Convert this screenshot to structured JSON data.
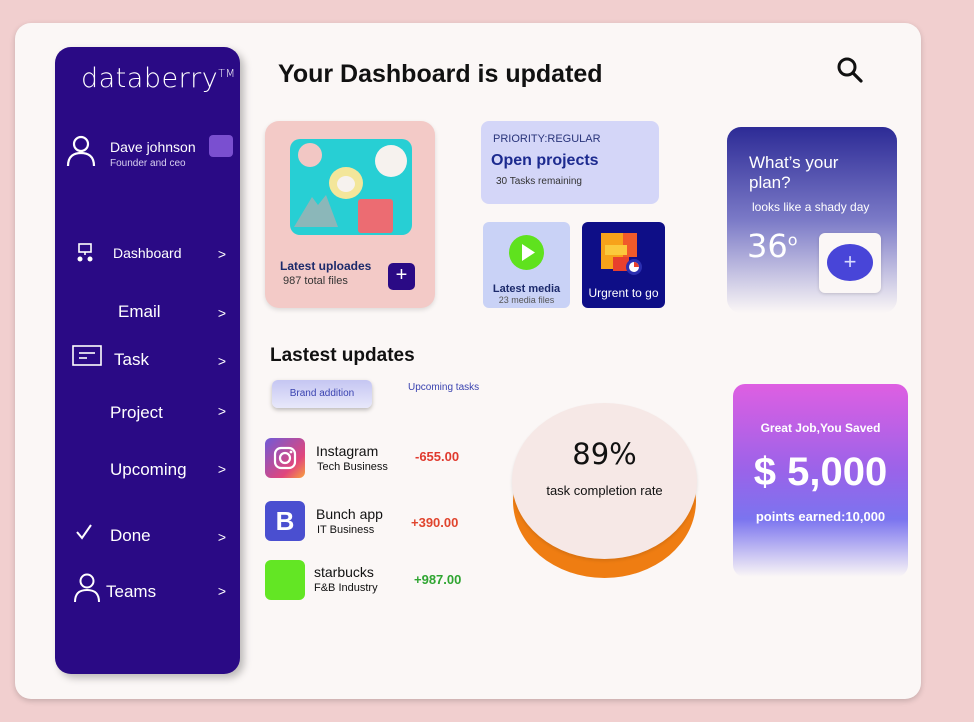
{
  "sidebar": {
    "logo": "databerry",
    "logo_tm": "TM",
    "user": {
      "name": "Dave johnson",
      "role": "Founder and ceo"
    },
    "items": [
      {
        "label": "Dashboard",
        "chevron": ">"
      },
      {
        "label": "Email",
        "chevron": ">"
      },
      {
        "label": "Task",
        "chevron": ">"
      },
      {
        "label": "Project",
        "chevron": ">"
      },
      {
        "label": "Upcoming",
        "chevron": ">"
      },
      {
        "label": "Done",
        "chevron": ">"
      },
      {
        "label": "Teams",
        "chevron": ">"
      }
    ]
  },
  "header": {
    "title": "Your Dashboard is updated",
    "search_icon": "search-icon"
  },
  "uploads": {
    "title": "Latest uploades",
    "subtitle": "987 total files",
    "button": "+"
  },
  "projects": {
    "priority": "PRIORITY:REGULAR",
    "title": "Open projects",
    "subtitle": "30 Tasks remaining"
  },
  "media": {
    "title": "Latest media",
    "subtitle": "23 media files"
  },
  "urgent": {
    "label": "Urgrent to go"
  },
  "plan": {
    "question": "What’s your plan?",
    "subtitle": "looks like a shady day",
    "temp": "36",
    "temp_unit": "o",
    "button": "+"
  },
  "updates": {
    "title": "Lastest updates",
    "tabs": [
      "Brand addition",
      "Upcoming tasks"
    ],
    "rows": [
      {
        "name": "Instagram",
        "category": "Tech Business",
        "amount": "-655.00",
        "color": "#e03a2e"
      },
      {
        "name": "Bunch app",
        "category": "IT Business",
        "amount": "+390.00",
        "color": "#e0452e"
      },
      {
        "name": "starbucks",
        "category": "F&B Industry",
        "amount": "+987.00",
        "color": "#2fa531"
      }
    ]
  },
  "completion": {
    "percent": "89%",
    "label": "task completion rate",
    "value": 89
  },
  "savings": {
    "title": "Great Job,You Saved",
    "amount": "$ 5,000",
    "points": "points earned:10,000"
  },
  "colors": {
    "sidebar": "#2a0a85",
    "accent": "#4845d8",
    "orange": "#ef7d12"
  }
}
